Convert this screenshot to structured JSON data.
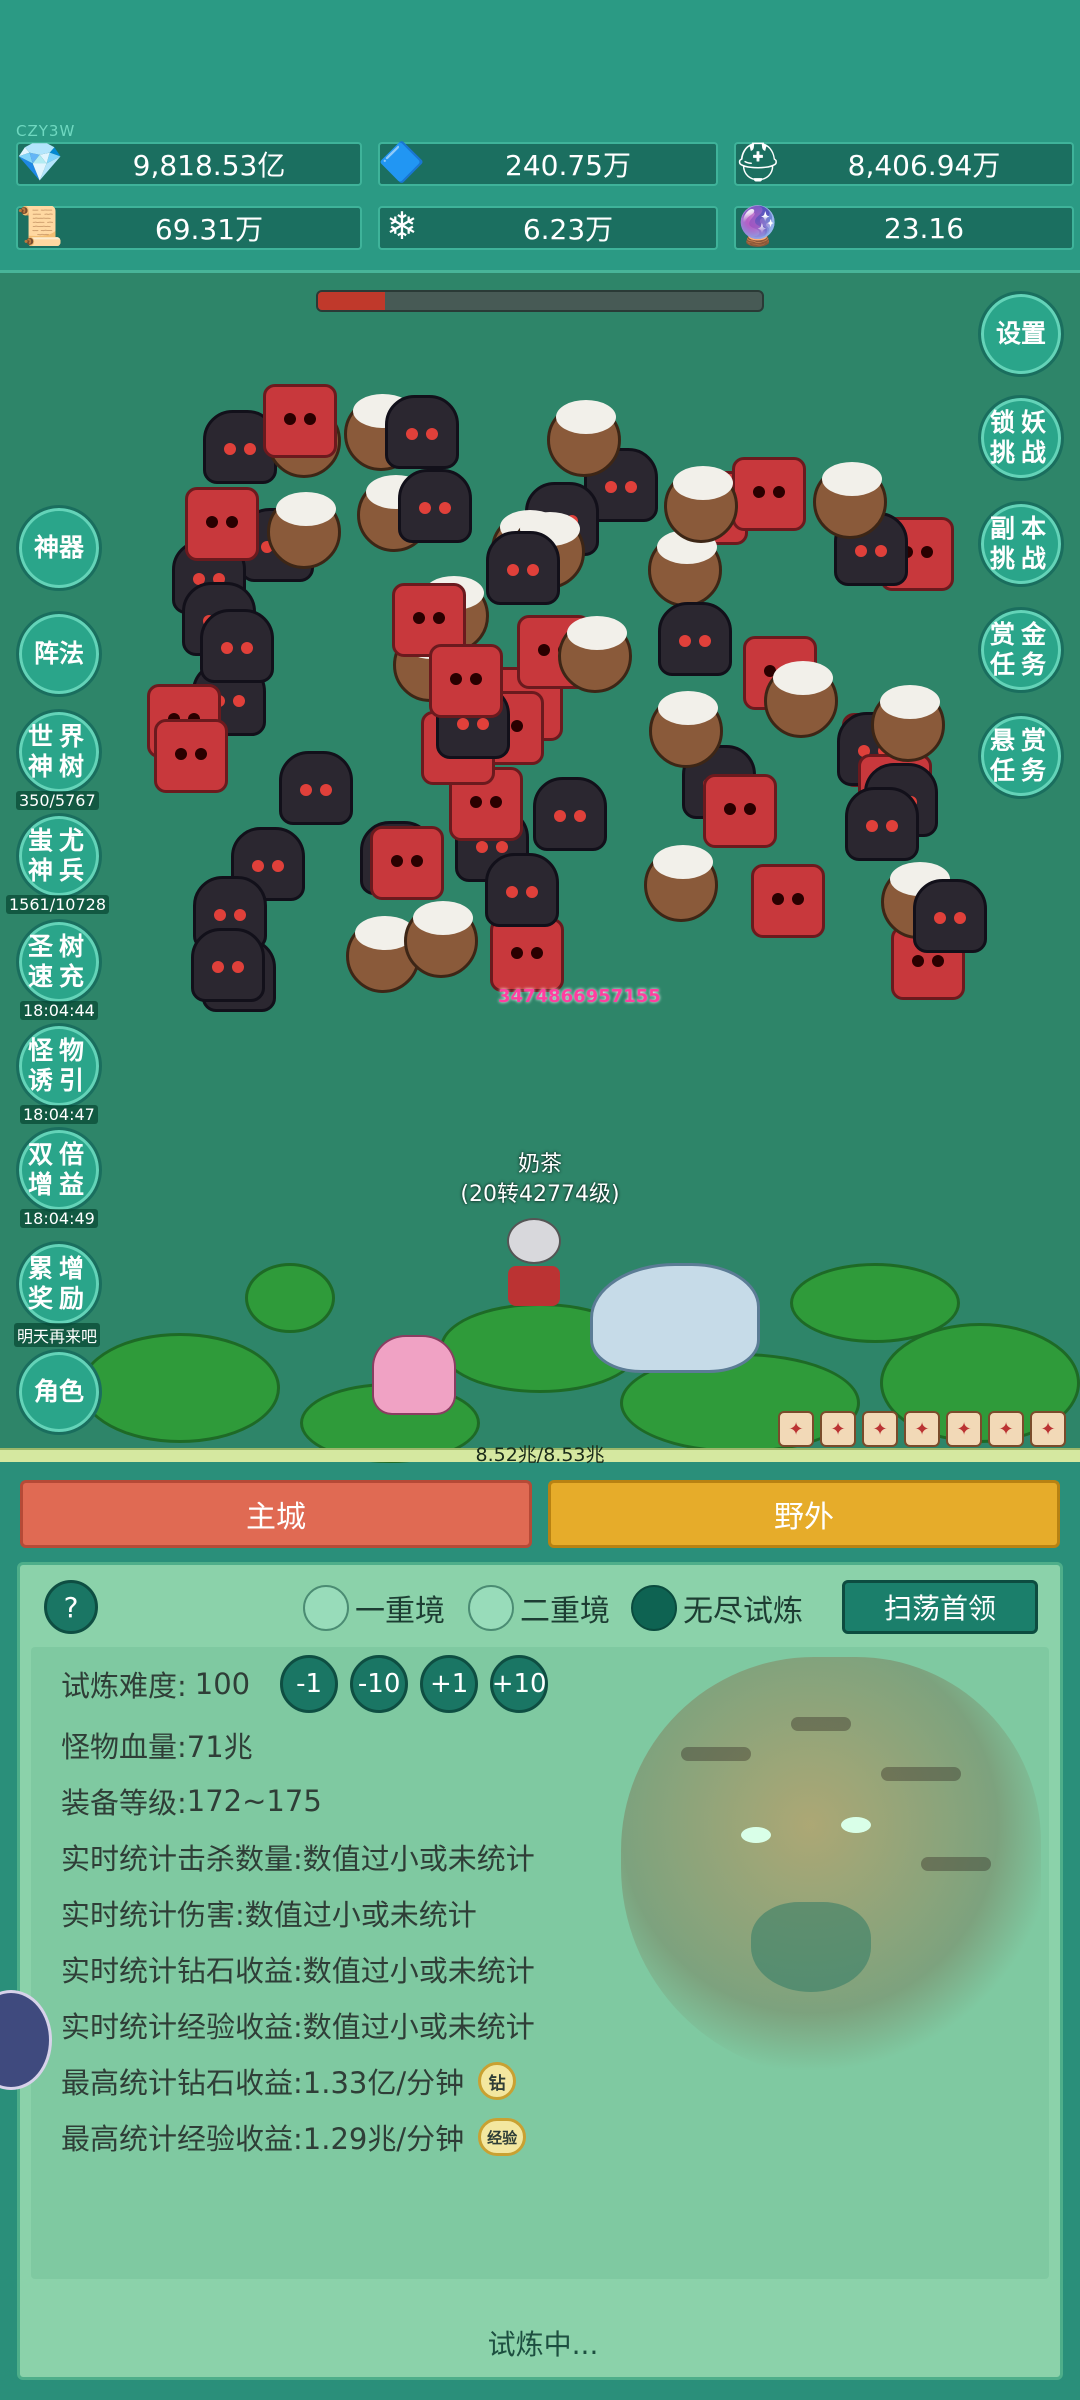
{
  "account_tag": "CZY3W",
  "resources": [
    {
      "icon": "purple-gem-icon",
      "symbol": "💎",
      "value": "9,818.53亿"
    },
    {
      "icon": "blue-crystal-icon",
      "symbol": "🔷",
      "value": "240.75万"
    },
    {
      "icon": "helmet-icon",
      "symbol": "⛑",
      "value": "8,406.94万"
    },
    {
      "icon": "scroll-icon",
      "symbol": "📜",
      "value": "69.31万"
    },
    {
      "icon": "ice-crystal-icon",
      "symbol": "❄",
      "value": "6.23万"
    },
    {
      "icon": "purple-orb-icon",
      "symbol": "🔮",
      "value": "23.16"
    }
  ],
  "boss_hp_fraction": 0.15,
  "left_menu": [
    {
      "id": "artifact",
      "label": "神器",
      "sub": ""
    },
    {
      "id": "formation",
      "label": "阵法",
      "sub": ""
    },
    {
      "id": "world-tree",
      "label": "世界神树",
      "sub": "350/5767"
    },
    {
      "id": "chiyou",
      "label": "蚩尤神兵",
      "sub": "1561/10728"
    },
    {
      "id": "tree-charge",
      "label": "圣树速充",
      "sub": "18:04:44"
    },
    {
      "id": "lure",
      "label": "怪物诱引",
      "sub": "18:04:47"
    },
    {
      "id": "double",
      "label": "双倍增益",
      "sub": "18:04:49"
    },
    {
      "id": "accum",
      "label": "累增奖励",
      "sub": "明天再来吧"
    },
    {
      "id": "role",
      "label": "角色",
      "sub": ""
    }
  ],
  "right_menu": [
    {
      "id": "settings",
      "label": "设置"
    },
    {
      "id": "lock-demon",
      "label": "锁妖挑战"
    },
    {
      "id": "dungeon",
      "label": "副本挑战"
    },
    {
      "id": "gold-task",
      "label": "赏金任务"
    },
    {
      "id": "bounty",
      "label": "悬赏任务"
    }
  ],
  "damage_number": "3474866957155",
  "hero": {
    "name": "奶茶",
    "level": "(20转42774级)"
  },
  "skill_icons": [
    "skill-1-icon",
    "skill-2-icon",
    "skill-3-icon",
    "skill-4-icon",
    "skill-5-icon",
    "skill-6-icon",
    "skill-7-icon"
  ],
  "player_hp": {
    "text": "8.52兆/8.53兆",
    "fraction": 0.999
  },
  "tabs": {
    "main_city": "主城",
    "wild": "野外"
  },
  "panel": {
    "help": "?",
    "modes": [
      {
        "label": "一重境",
        "selected": false
      },
      {
        "label": "二重境",
        "selected": false
      },
      {
        "label": "无尽试炼",
        "selected": true
      }
    ],
    "sweep_button": "扫荡首领",
    "difficulty_label": "试炼难度:",
    "difficulty_value": "100",
    "step_buttons": [
      "-1",
      "-10",
      "+1",
      "+10"
    ],
    "stats": [
      {
        "label": "怪物血量:",
        "value": "71兆"
      },
      {
        "label": "装备等级:",
        "value": "172~175"
      },
      {
        "label": "实时统计击杀数量:",
        "value": "数值过小或未统计"
      },
      {
        "label": "实时统计伤害:",
        "value": "数值过小或未统计"
      },
      {
        "label": "实时统计钻石收益:",
        "value": "数值过小或未统计"
      },
      {
        "label": "实时统计经验收益:",
        "value": "数值过小或未统计"
      }
    ],
    "best_diamond": {
      "label": "最高统计钻石收益:",
      "value": "1.33亿/分钟",
      "badge": "钻"
    },
    "best_exp": {
      "label": "最高统计经验收益:",
      "value": "1.29兆/分钟",
      "badge": "经验"
    },
    "status": "试炼中..."
  }
}
